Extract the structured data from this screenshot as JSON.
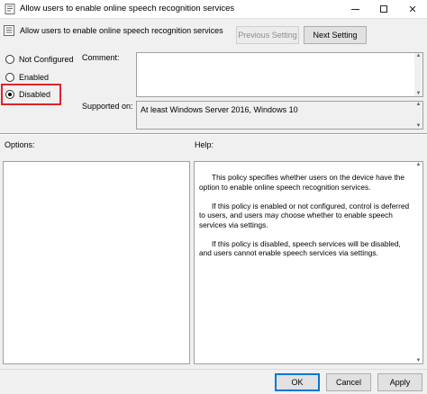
{
  "window": {
    "title": "Allow users to enable online speech recognition services",
    "minimize_icon": "minimize-icon",
    "maximize_icon": "maximize-icon",
    "close_glyph": "✕"
  },
  "policy": {
    "name": "Allow users to enable online speech recognition services"
  },
  "nav": {
    "previous_label": "Previous Setting",
    "next_label": "Next Setting"
  },
  "state": {
    "options": [
      {
        "label": "Not Configured",
        "checked": false
      },
      {
        "label": "Enabled",
        "checked": false
      },
      {
        "label": "Disabled",
        "checked": true
      }
    ],
    "highlight_color": "#d9262b"
  },
  "comment": {
    "label": "Comment:",
    "value": ""
  },
  "supported": {
    "label": "Supported on:",
    "value": "At least Windows Server 2016, Windows 10"
  },
  "options_panel": {
    "label": "Options:"
  },
  "help_panel": {
    "label": "Help:",
    "paragraphs": [
      "This policy specifies whether users on the device have the option to enable online speech recognition services.",
      "If this policy is enabled or not configured, control is deferred to users, and users may choose whether to enable speech services via settings.",
      "If this policy is disabled, speech services will be disabled, and users cannot enable speech services via settings."
    ]
  },
  "footer": {
    "ok_label": "OK",
    "cancel_label": "Cancel",
    "apply_label": "Apply"
  },
  "colors": {
    "accent": "#0078d7",
    "background": "#f0f0f0"
  }
}
